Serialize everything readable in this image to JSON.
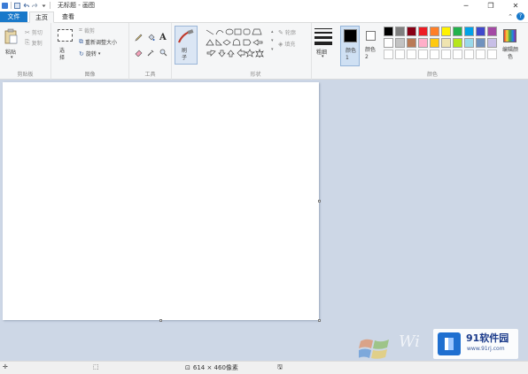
{
  "titlebar": {
    "title": "无标题 - 画图"
  },
  "tabs": {
    "file": "文件",
    "home": "主页",
    "view": "查看"
  },
  "clipboard": {
    "paste": "粘贴",
    "cut": "剪切",
    "copy": "复制",
    "label": "剪贴板"
  },
  "image": {
    "select": "选择",
    "crop": "裁剪",
    "resize": "重新调整大小",
    "rotate": "旋转",
    "label": "图像"
  },
  "tools": {
    "label": "工具",
    "text_tool": "A"
  },
  "brushes": {
    "label": "刷子"
  },
  "shapes": {
    "outline": "轮廓",
    "fill": "填充",
    "label": "形状"
  },
  "size": {
    "label": "粗细"
  },
  "colors": {
    "color1": "颜色 1",
    "color2": "颜色 2",
    "edit": "编辑颜色",
    "label": "颜色",
    "color1_value": "#000000",
    "color2_value": "#ffffff",
    "palette_row1": [
      "#000000",
      "#7f7f7f",
      "#880015",
      "#ed1c24",
      "#ff7f27",
      "#fff200",
      "#22b14c",
      "#00a2e8",
      "#3f48cc",
      "#a349a4"
    ],
    "palette_row2": [
      "#ffffff",
      "#c3c3c3",
      "#b97a57",
      "#ffaec9",
      "#ffc90e",
      "#efe4b0",
      "#b5e61d",
      "#99d9ea",
      "#7092be",
      "#c8bfe7"
    ]
  },
  "statusbar": {
    "canvas_size": "614 × 460像素"
  },
  "watermark": {
    "win_text": "Wi",
    "site_name": "91软件园",
    "site_url": "www.91rj.com"
  }
}
